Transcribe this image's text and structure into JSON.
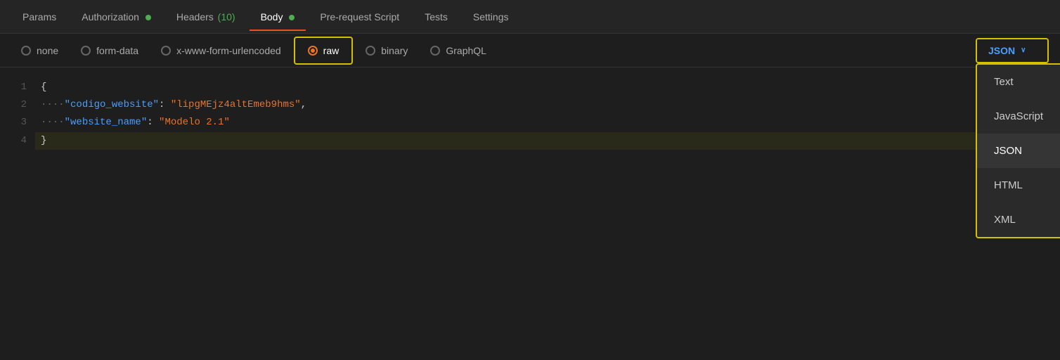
{
  "tabs": [
    {
      "id": "params",
      "label": "Params",
      "active": false,
      "dot": null,
      "count": null
    },
    {
      "id": "authorization",
      "label": "Authorization",
      "active": false,
      "dot": "green",
      "count": null
    },
    {
      "id": "headers",
      "label": "Headers",
      "active": false,
      "dot": null,
      "count": "10",
      "count_color": "green"
    },
    {
      "id": "body",
      "label": "Body",
      "active": true,
      "dot": "green",
      "count": null
    },
    {
      "id": "pre-request-script",
      "label": "Pre-request Script",
      "active": false,
      "dot": null,
      "count": null
    },
    {
      "id": "tests",
      "label": "Tests",
      "active": false,
      "dot": null,
      "count": null
    },
    {
      "id": "settings",
      "label": "Settings",
      "active": false,
      "dot": null,
      "count": null
    }
  ],
  "body_options": [
    {
      "id": "none",
      "label": "none",
      "selected": false
    },
    {
      "id": "form-data",
      "label": "form-data",
      "selected": false
    },
    {
      "id": "x-www-form-urlencoded",
      "label": "x-www-form-urlencoded",
      "selected": false
    },
    {
      "id": "raw",
      "label": "raw",
      "selected": true
    },
    {
      "id": "binary",
      "label": "binary",
      "selected": false
    },
    {
      "id": "graphql",
      "label": "GraphQL",
      "selected": false
    }
  ],
  "json_dropdown": {
    "label": "JSON",
    "chevron": "∨",
    "options": [
      {
        "id": "text",
        "label": "Text",
        "selected": false
      },
      {
        "id": "javascript",
        "label": "JavaScript",
        "selected": false
      },
      {
        "id": "json",
        "label": "JSON",
        "selected": true
      },
      {
        "id": "html",
        "label": "HTML",
        "selected": false
      },
      {
        "id": "xml",
        "label": "XML",
        "selected": false
      }
    ]
  },
  "code_lines": [
    {
      "number": "1",
      "content_type": "brace_open"
    },
    {
      "number": "2",
      "content_type": "key_value",
      "key": "\"codigo_website\"",
      "value": "\"lipgMEjz4altEmeb9hms\"",
      "comma": true
    },
    {
      "number": "3",
      "content_type": "key_value",
      "key": "\"website_name\"",
      "value": "\"Modelo 2.1\"",
      "comma": false
    },
    {
      "number": "4",
      "content_type": "brace_close",
      "highlighted": true
    }
  ]
}
